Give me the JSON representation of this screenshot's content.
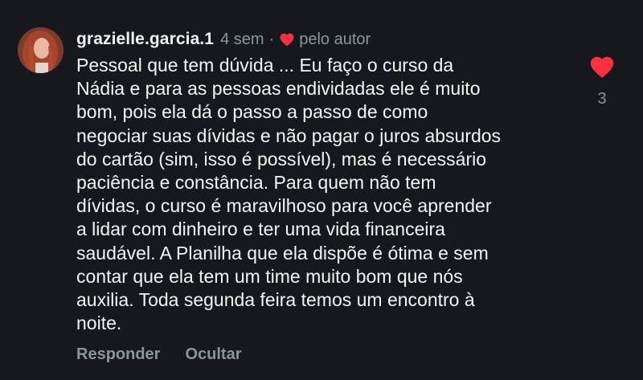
{
  "comment": {
    "username": "grazielle.garcia.1",
    "time": "4 sem",
    "separator": "·",
    "author_label": "pelo autor",
    "body_lines": [
      "Pessoal que tem dúvida ... Eu faço o curso da",
      "Nádia e para as pessoas endividadas ele é muito",
      "bom, pois ela dá o passo a passo de como",
      "negociar suas dívidas e não pagar o juros absurdos",
      "do cartão (sim, isso é possível), mas é necessário",
      "paciência e constância. Para quem não tem",
      "dívidas, o curso é maravilhoso para você aprender",
      "a lidar com dinheiro e ter uma vida financeira",
      "saudável. A Planilha que ela dispõe é ótima e sem",
      "contar que ela tem um time muito bom que nós",
      "auxilia. Toda segunda feira temos um encontro à",
      "noite."
    ],
    "like_count": "3",
    "actions": {
      "reply": "Responder",
      "hide": "Ocultar"
    }
  },
  "icons": {
    "like": "heart-icon",
    "author_like": "heart-icon",
    "avatar": "profile-photo"
  },
  "colors": {
    "background": "#15191d",
    "heart": "#ff3040",
    "primary_text": "#f4f4f4",
    "secondary_text": "#8d9399"
  }
}
